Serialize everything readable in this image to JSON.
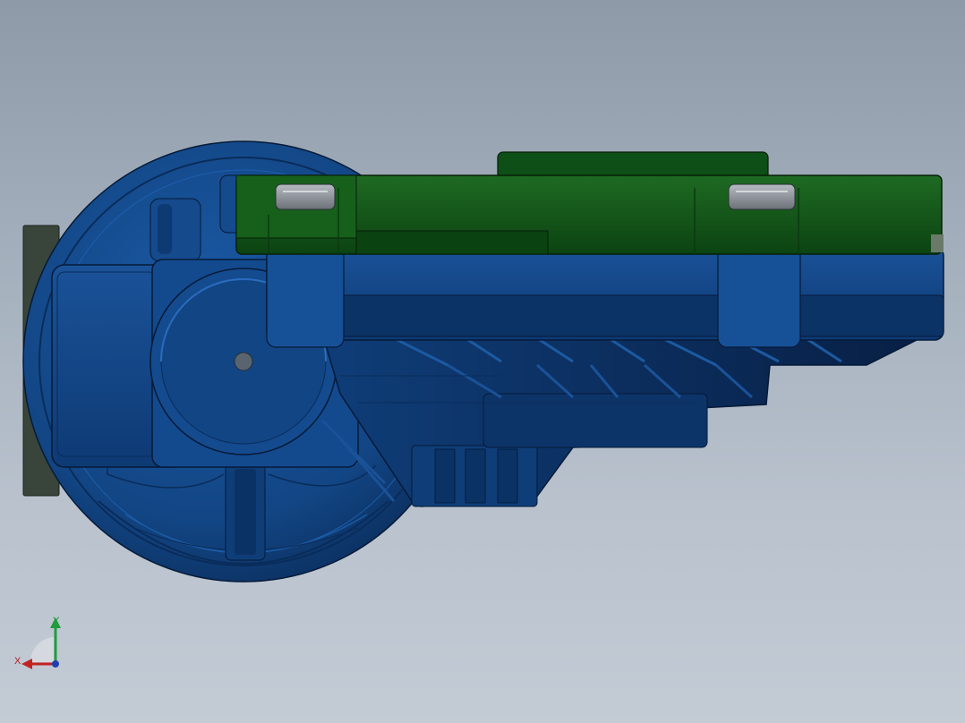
{
  "viewport": {
    "background_top": "#8e9aa8",
    "background_bottom": "#c3cbd5"
  },
  "model": {
    "housing_color": "#134a8e",
    "housing_dark": "#0a2c5a",
    "housing_edge": "#061a38",
    "cover_color": "#0d4f16",
    "cover_light": "#1f6a22",
    "backplate_color": "#39453a",
    "bolt_color": "#8a8f96",
    "components": [
      "wheel-rim",
      "motor-housing",
      "gearbox-housing",
      "mounting-plate",
      "mount-bolt",
      "mount-bolt",
      "axle-hole",
      "back-plate"
    ]
  },
  "triad": {
    "x_label": "X",
    "y_label": "Y",
    "x_color": "#c22222",
    "y_color": "#1f9c3c",
    "z_color": "#1f3fb0"
  }
}
